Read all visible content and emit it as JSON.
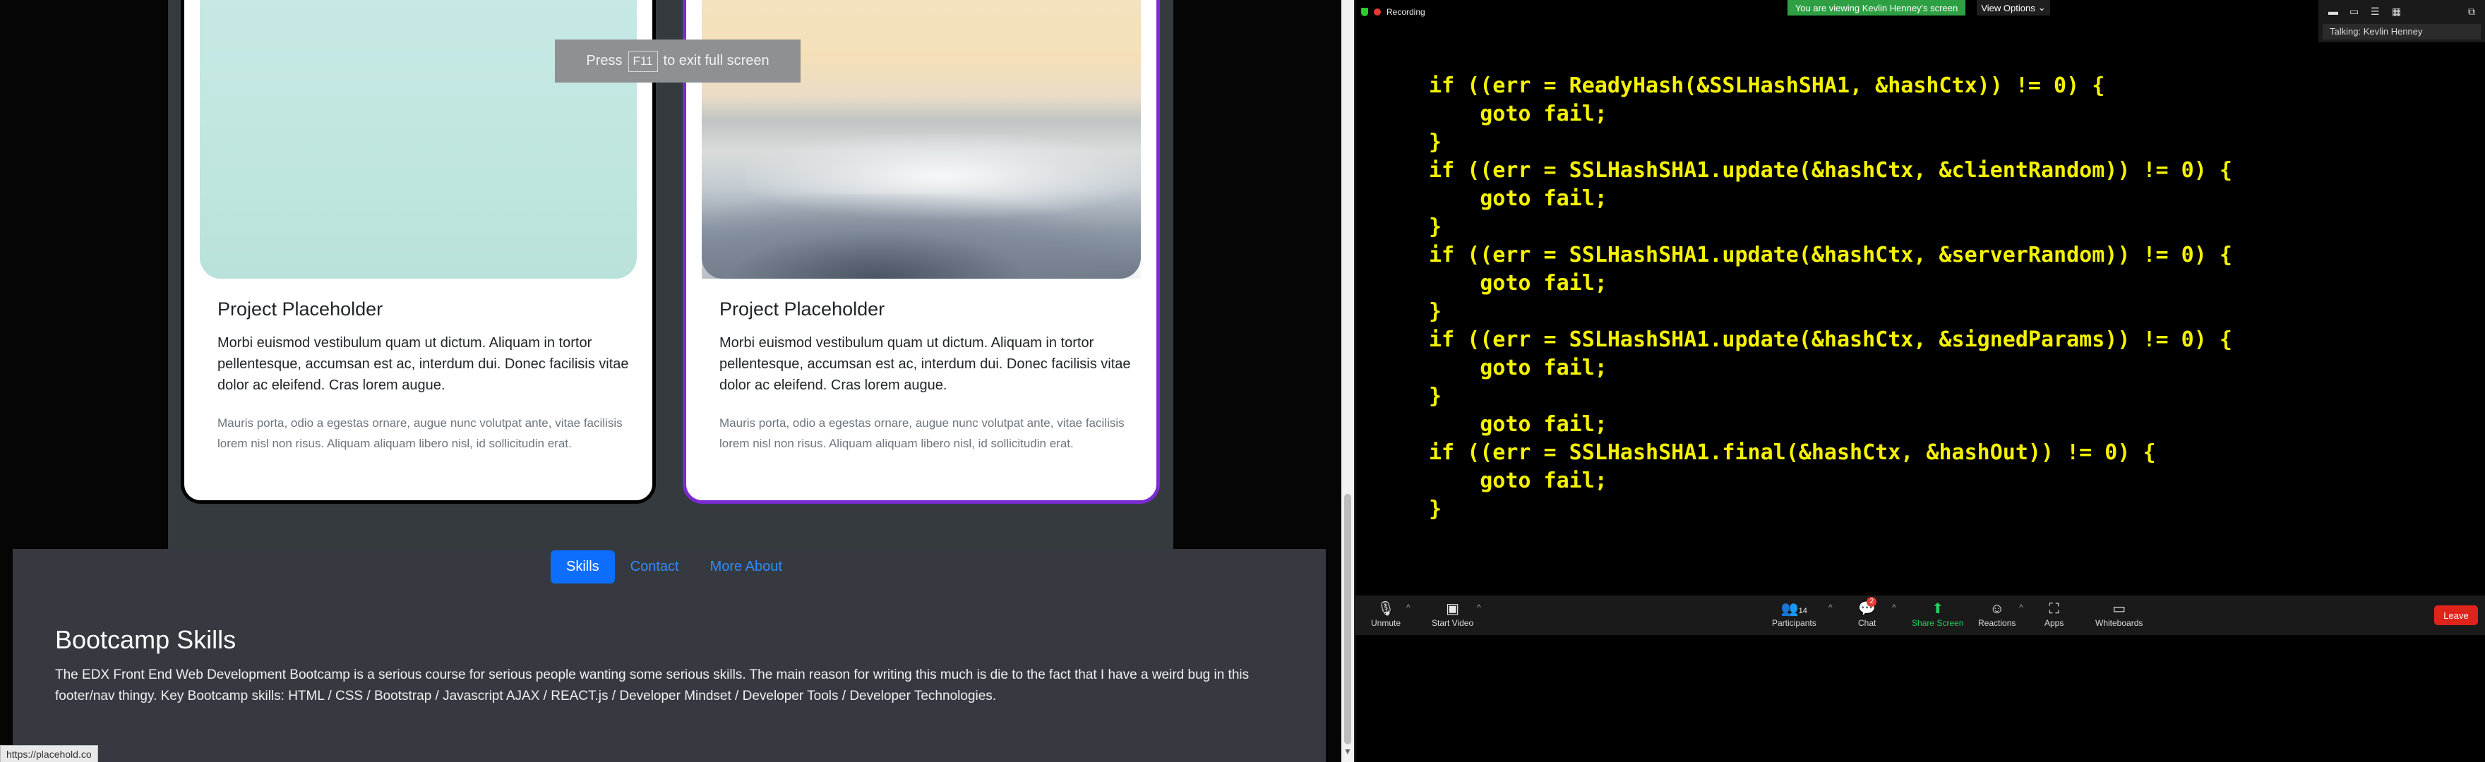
{
  "browser": {
    "fullscreen_toast": {
      "press": "Press",
      "key": "F11",
      "suffix": "to exit full screen"
    },
    "status_url": "https://placehold.co"
  },
  "portfolio": {
    "cards": [
      {
        "title": "Project Placeholder",
        "text": "Morbi euismod vestibulum quam ut dictum. Aliquam in tortor pellentesque, accumsan est ac, interdum dui. Donec facilisis vitae dolor ac eleifend. Cras lorem augue.",
        "muted": "Mauris porta, odio a egestas ornare, augue nunc volutpat ante, vitae facilisis lorem nisl non risus. Aliquam aliquam libero nisl, id sollicitudin erat."
      },
      {
        "title": "Project Placeholder",
        "text": "Morbi euismod vestibulum quam ut dictum. Aliquam in tortor pellentesque, accumsan est ac, interdum dui. Donec facilisis vitae dolor ac eleifend. Cras lorem augue.",
        "muted": "Mauris porta, odio a egestas ornare, augue nunc volutpat ante, vitae facilisis lorem nisl non risus. Aliquam aliquam libero nisl, id sollicitudin erat."
      }
    ],
    "footer": {
      "nav": [
        "Skills",
        "Contact",
        "More About"
      ],
      "title": "Bootcamp Skills",
      "text": "The EDX Front End Web Development Bootcamp is a serious course for serious people wanting some serious skills. The main reason for writing this much is die to the fact that I have a weird bug in this footer/nav thingy. Key Bootcamp skills: HTML / CSS / Bootstrap / Javascript AJAX / REACT.js / Developer Mindset / Developer Tools / Developer Technologies."
    }
  },
  "zoom": {
    "recording_label": "Recording",
    "share_banner": "You are viewing Kevlin Henney's screen",
    "view_options": "View Options",
    "talking": "Talking: Kevlin Henney",
    "code": "if ((err = ReadyHash(&SSLHashSHA1, &hashCtx)) != 0) {\n    goto fail;\n}\nif ((err = SSLHashSHA1.update(&hashCtx, &clientRandom)) != 0) {\n    goto fail;\n}\nif ((err = SSLHashSHA1.update(&hashCtx, &serverRandom)) != 0) {\n    goto fail;\n}\nif ((err = SSLHashSHA1.update(&hashCtx, &signedParams)) != 0) {\n    goto fail;\n}\n    goto fail;\nif ((err = SSLHashSHA1.final(&hashCtx, &hashOut)) != 0) {\n    goto fail;\n}",
    "toolbar": {
      "unmute": "Unmute",
      "start_video": "Start Video",
      "participants": "Participants",
      "participants_count": "14",
      "chat": "Chat",
      "chat_badge": "2",
      "share_screen": "Share Screen",
      "reactions": "Reactions",
      "apps": "Apps",
      "whiteboards": "Whiteboards",
      "leave": "Leave"
    },
    "colors": {
      "code": "#f4f200",
      "share_banner": "#2ea043",
      "share_screen": "#23d160",
      "leave": "#e0241c"
    }
  }
}
